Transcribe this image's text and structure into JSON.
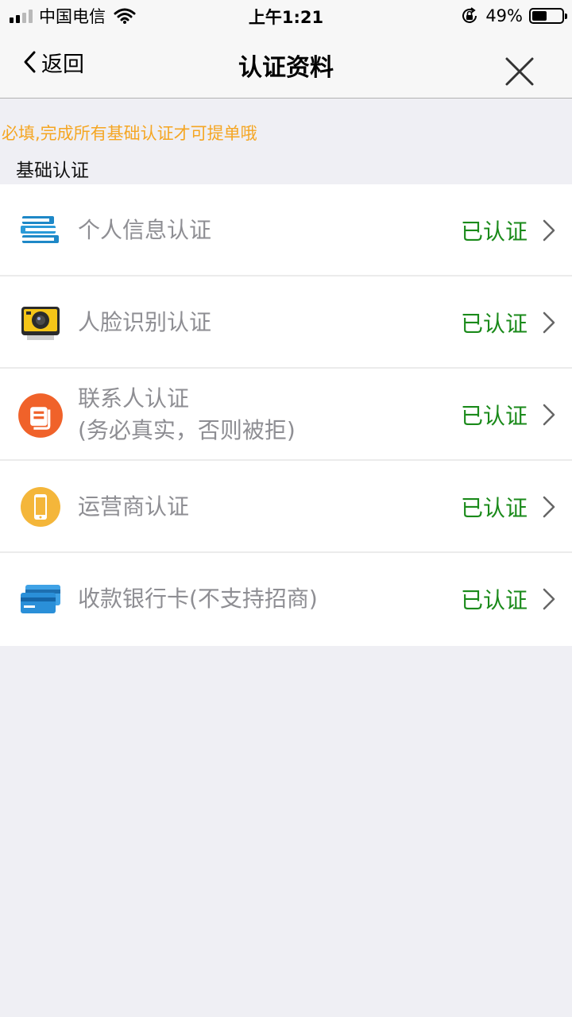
{
  "status_bar": {
    "carrier": "中国电信",
    "time": "上午1:21",
    "battery_percent": "49%",
    "battery_level": 0.49,
    "signal_bars_active": 2,
    "icons": [
      "signal-icon",
      "wifi-icon",
      "orientation-lock-icon",
      "battery-icon"
    ]
  },
  "nav": {
    "back_label": "返回",
    "title": "认证资料",
    "icons": [
      "back-chevron-icon",
      "close-icon"
    ]
  },
  "notice": "必填,完成所有基础认证才可提单哦",
  "section_title": "基础认证",
  "colors": {
    "notice": "#f5a623",
    "status_verified": "#1a8a1a",
    "label": "#8e8e93",
    "background": "#efeff4"
  },
  "items": [
    {
      "icon": "books-icon",
      "label": "个人信息认证",
      "sub_label": "",
      "status": "已认证"
    },
    {
      "icon": "camera-icon",
      "label": "人脸识别认证",
      "sub_label": "",
      "status": "已认证"
    },
    {
      "icon": "contacts-icon",
      "label": "联系人认证",
      "sub_label": "(务必真实，否则被拒)",
      "status": "已认证"
    },
    {
      "icon": "phone-icon",
      "label": "运营商认证",
      "sub_label": "",
      "status": "已认证"
    },
    {
      "icon": "bank-card-icon",
      "label": "收款银行卡(不支持招商)",
      "sub_label": "",
      "status": "已认证"
    }
  ]
}
